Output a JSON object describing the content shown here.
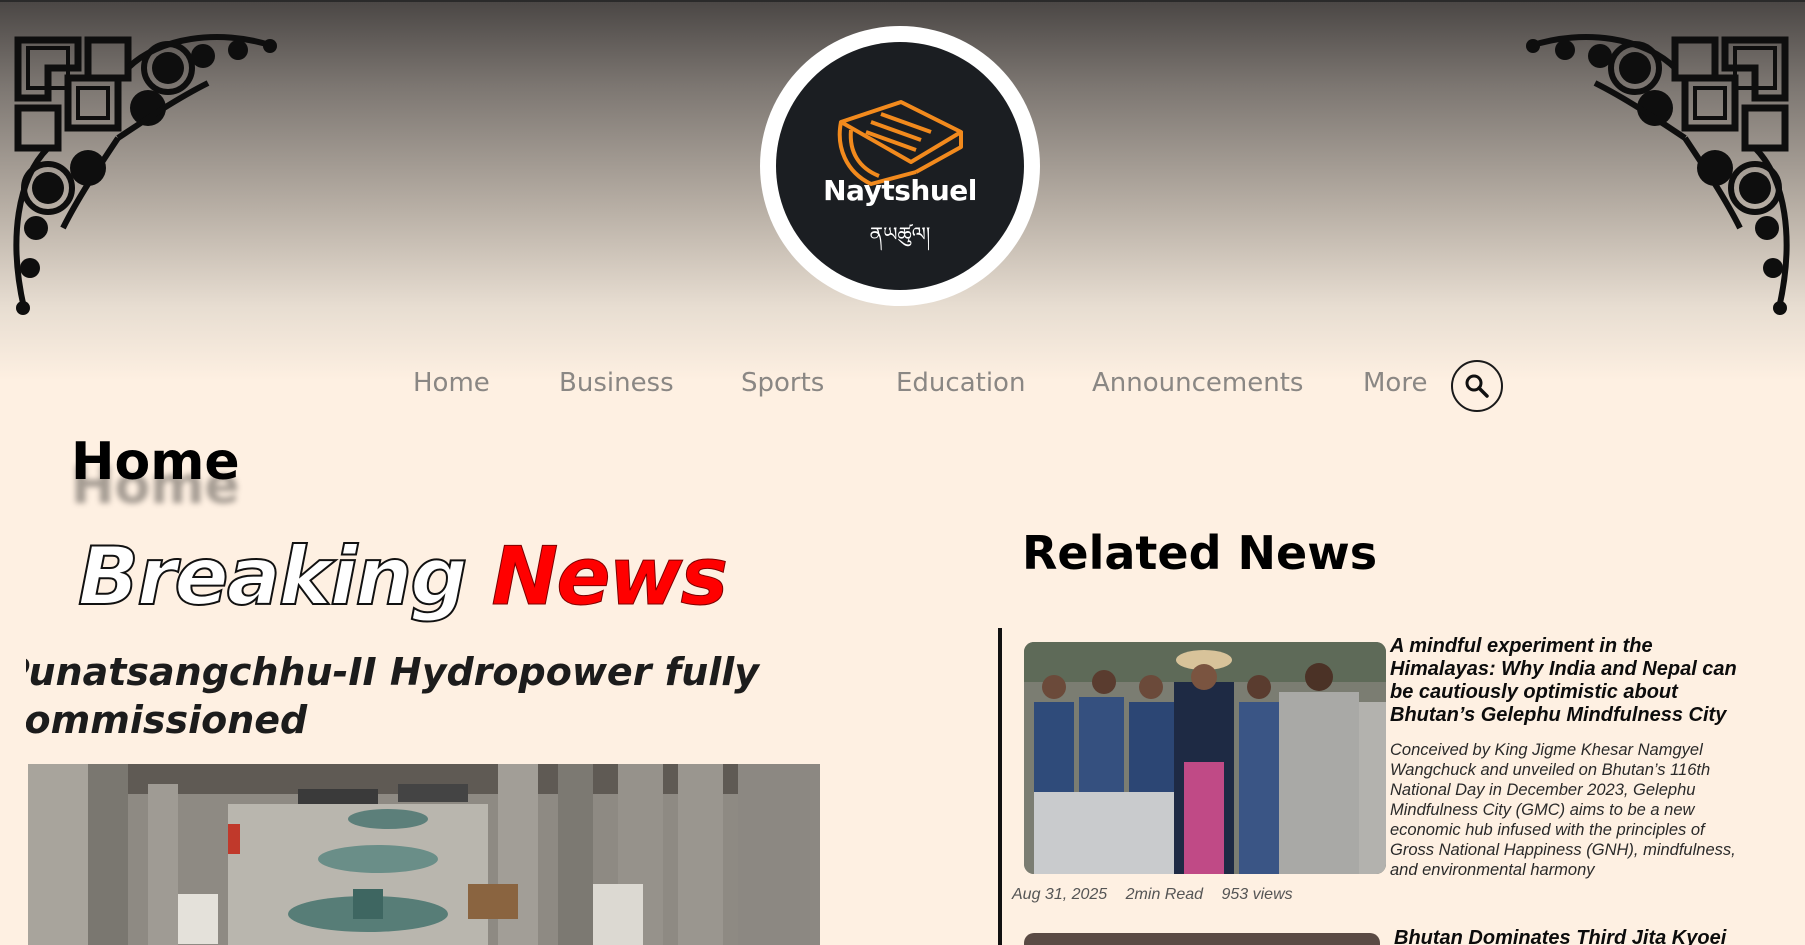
{
  "brand": {
    "name": "Naytshuel",
    "script_text": "ནཡཚུལ།",
    "accent_color": "#f28a1d",
    "disc_color": "#1b1e22"
  },
  "nav": {
    "items": [
      "Home",
      "Business",
      "Sports",
      "Education",
      "Announcements",
      "More"
    ],
    "search_icon": "search-icon"
  },
  "page": {
    "title": "Home"
  },
  "breaking": {
    "word1": "Breaking",
    "word2": "News",
    "headline": "Punatsangchhu-II Hydropower fully commissioned"
  },
  "related": {
    "title": "Related News",
    "items": [
      {
        "title": "A mindful experiment in the Himalayas: Why India and Nepal can be cautiously optimistic about Bhutan’s Gelephu Mindfulness City",
        "excerpt": "Conceived by King Jigme Khesar Namgyel Wangchuck and unveiled on Bhutan’s 116th National Day in December 2023, Gelephu Mindfulness City (GMC) aims to be a new economic hub infused with the principles of Gross National Happiness (GNH), mindfulness, and environmental harmony",
        "date": "Aug 31, 2025",
        "read_time": "2min Read",
        "views": "953 views"
      },
      {
        "title": "Bhutan Dominates Third Jita Kyoei"
      }
    ]
  }
}
